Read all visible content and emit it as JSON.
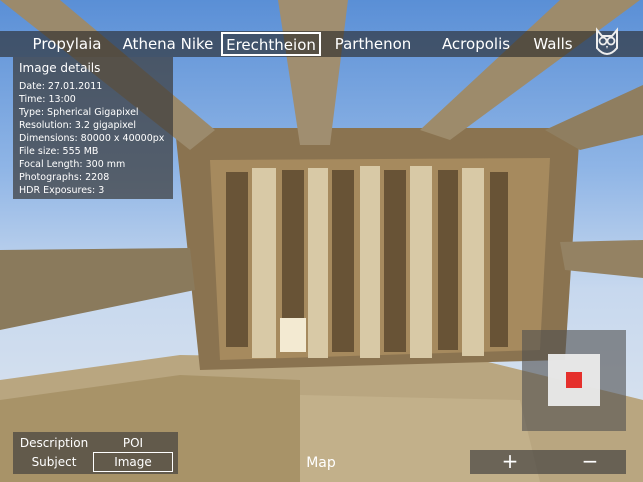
{
  "nav": {
    "items": [
      {
        "label": "Propylaia",
        "active": false
      },
      {
        "label": "Athena Nike",
        "active": false
      },
      {
        "label": "Erechtheion",
        "active": true
      },
      {
        "label": "Parthenon",
        "active": false
      },
      {
        "label": "Acropolis",
        "active": false
      },
      {
        "label": "Walls",
        "active": false
      }
    ]
  },
  "details": {
    "title": "Image details",
    "rows": [
      "Date: 27.01.2011",
      "Time: 13:00",
      "Type: Spherical Gigapixel",
      "Resolution: 3.2 gigapixel",
      "Dimensions: 80000 x 40000px",
      "File size: 555 MB",
      "Focal Length: 300 mm",
      "Photographs: 2208",
      "HDR Exposures: 3"
    ]
  },
  "bottom": {
    "description_label": "Description",
    "poi_label": "POI",
    "subject_label": "Subject",
    "image_label": "Image",
    "map_label": "Map"
  },
  "zoom": {
    "in_label": "+",
    "out_label": "−"
  },
  "colors": {
    "minimap_marker": "#e5302c",
    "nav_bg": "#282828"
  },
  "icons": {
    "owl": "owl-logo-icon"
  }
}
